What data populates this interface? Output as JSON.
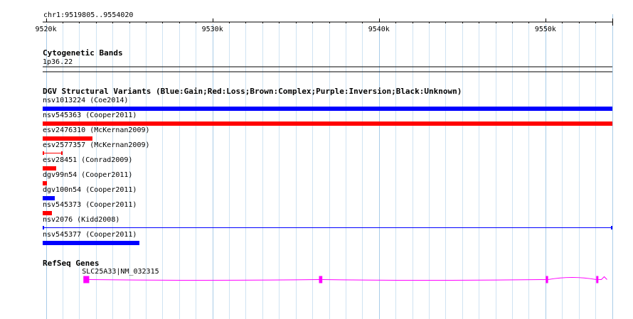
{
  "region": "chr1:9519805..9554020",
  "ruler": {
    "start": 9519805,
    "end": 9554020,
    "tick_labels": [
      {
        "pos": 9520000,
        "label": "9520k"
      },
      {
        "pos": 9530000,
        "label": "9530k"
      },
      {
        "pos": 9540000,
        "label": "9540k"
      },
      {
        "pos": 9550000,
        "label": "9550k"
      }
    ],
    "minor_step": 1000
  },
  "tracks": {
    "cytoband": {
      "title": "Cytogenetic Bands",
      "band_label": "1p36.22"
    },
    "dgv": {
      "title": "DGV Structural Variants (Blue:Gain;Red:Loss;Brown:Complex;Purple:Inversion;Black:Unknown)",
      "colors": {
        "gain": "#0000ff",
        "loss": "#ff0000"
      },
      "features": [
        {
          "label": "nsv1013224 (Coe2014)",
          "start": 9519805,
          "end": 9554020,
          "type": "gain",
          "style": "thick"
        },
        {
          "label": "nsv545363 (Cooper2011)",
          "start": 9519805,
          "end": 9554020,
          "type": "loss",
          "style": "thick"
        },
        {
          "label": "esv2476310 (McKernan2009)",
          "start": 9519805,
          "end": 9522800,
          "type": "loss",
          "style": "thick"
        },
        {
          "label": "esv2577357 (McKernan2009)",
          "start": 9519805,
          "end": 9521000,
          "type": "loss",
          "style": "line"
        },
        {
          "label": "esv28451 (Conrad2009)",
          "start": 9519805,
          "end": 9520600,
          "type": "loss",
          "style": "thick"
        },
        {
          "label": "dgv99n54 (Cooper2011)",
          "start": 9519805,
          "end": 9520080,
          "type": "loss",
          "style": "thick"
        },
        {
          "label": "dgv100n54 (Cooper2011)",
          "start": 9519805,
          "end": 9520550,
          "type": "gain",
          "style": "thick"
        },
        {
          "label": "nsv545373 (Cooper2011)",
          "start": 9519805,
          "end": 9520350,
          "type": "loss",
          "style": "thick"
        },
        {
          "label": "nsv2076 (Kidd2008)",
          "start": 9519805,
          "end": 9554020,
          "type": "gain",
          "style": "line"
        },
        {
          "label": "nsv545377 (Cooper2011)",
          "start": 9519805,
          "end": 9525600,
          "type": "gain",
          "style": "thick"
        }
      ]
    },
    "refseq": {
      "title": "RefSeq Genes",
      "color": "#ff00ff",
      "gene": {
        "label": "SLC25A33|NM_032315",
        "start": 9522250,
        "end": 9553700,
        "exons": [
          {
            "start": 9522250,
            "end": 9522600
          },
          {
            "start": 9536400,
            "end": 9536600
          },
          {
            "start": 9550020,
            "end": 9550160
          },
          {
            "start": 9553050,
            "end": 9553180
          }
        ]
      }
    }
  }
}
